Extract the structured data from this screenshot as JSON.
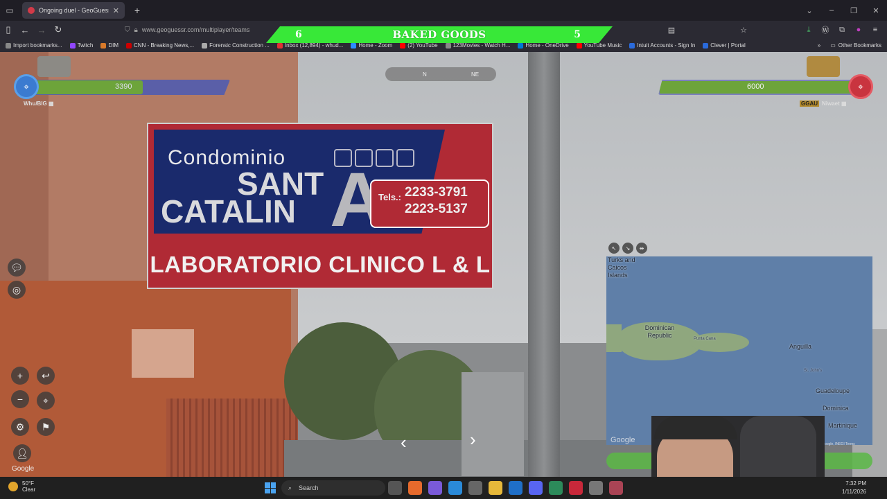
{
  "browser": {
    "tab_title": "Ongoing duel - GeoGuessr",
    "url": "www.geoguessr.com/multiplayer/teams",
    "bookmarks": [
      "Import bookmarks...",
      "Twitch",
      "DIM",
      "CNN - Breaking News,...",
      "Forensic Construction ...",
      "Inbox (12,894) - whud...",
      "Home - Zoom",
      "(2) YouTube",
      "123Movies - Watch H...",
      "Home - OneDrive",
      "YouTube Music",
      "Intuit Accounts - Sign In",
      "Clever | Portal"
    ],
    "other_bookmarks": "Other Bookmarks"
  },
  "banner": {
    "left_score": "6",
    "title": "BAKED GOODS",
    "right_score": "5",
    "color": "#38e838"
  },
  "players": {
    "left": {
      "health": "3390",
      "name": "Whu/BIG",
      "color": "#3b7bd0"
    },
    "right": {
      "health": "6000",
      "tag": "GGAU",
      "name": "Niwaet",
      "color": "#c9343f"
    }
  },
  "compass": {
    "n": "N",
    "ne": "NE"
  },
  "sign": {
    "line1": "Condominio",
    "line2a": "SANT",
    "line2b": "CATALIN",
    "big_letter": "A",
    "tels_label": "Tels.:",
    "tel1": "2233-3791",
    "tel2": "2223-5137",
    "lab": "LABORATORIO CLINICO L & L"
  },
  "map": {
    "labels": [
      "Turks and Caicos Islands",
      "Dominican Republic",
      "Punta Cana",
      "Anguilla",
      "St. John's",
      "Guadeloupe",
      "Dominica",
      "Martinique"
    ],
    "google": "Google",
    "attribution": "©2026 Google, INEGI  Terms"
  },
  "streetview": {
    "google": "Google"
  },
  "taskbar": {
    "temp": "50°F",
    "condition": "Clear",
    "search": "Search",
    "time": "7:32 PM",
    "date": "1/11/2026"
  }
}
